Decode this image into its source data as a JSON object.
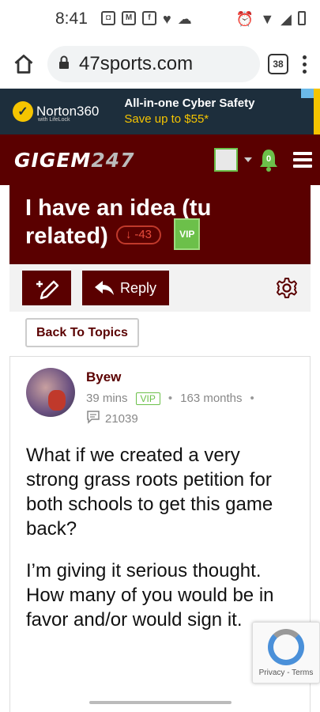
{
  "status": {
    "time": "8:41"
  },
  "browser": {
    "url": "​47sports.com",
    "tab_count": "38"
  },
  "ad": {
    "brand": "Norton360",
    "brand_sub": "with LifeLock",
    "line1": "All-in-one Cyber Safety",
    "line2": "Save up to $55*",
    "colors": {
      "bg": "#1d2e3c",
      "accent": "#f5c400"
    }
  },
  "header": {
    "logo_text": "GIGEM",
    "logo_num": "247",
    "notification_count": "0"
  },
  "thread": {
    "title": "I have an idea (tu related)",
    "vote": "-43",
    "vip": "VIP"
  },
  "toolbar": {
    "reply_label": "Reply"
  },
  "back_label": "Back To Topics",
  "post": {
    "username": "Byew",
    "time_ago": "39 mins",
    "vip": "VIP",
    "tenure": "163 months",
    "post_count": "21039",
    "paragraphs": [
      "What if we created a very strong grass roots petition for both schools to get this game back?",
      "I’m giving it serious thought. How many of you would be in favor and/or would sign it."
    ]
  },
  "recaptcha": {
    "text": "Privacy - Terms"
  },
  "colors": {
    "maroon": "#5a0000",
    "vip_green": "#6cc04a",
    "vote_red": "#e74c3c"
  }
}
